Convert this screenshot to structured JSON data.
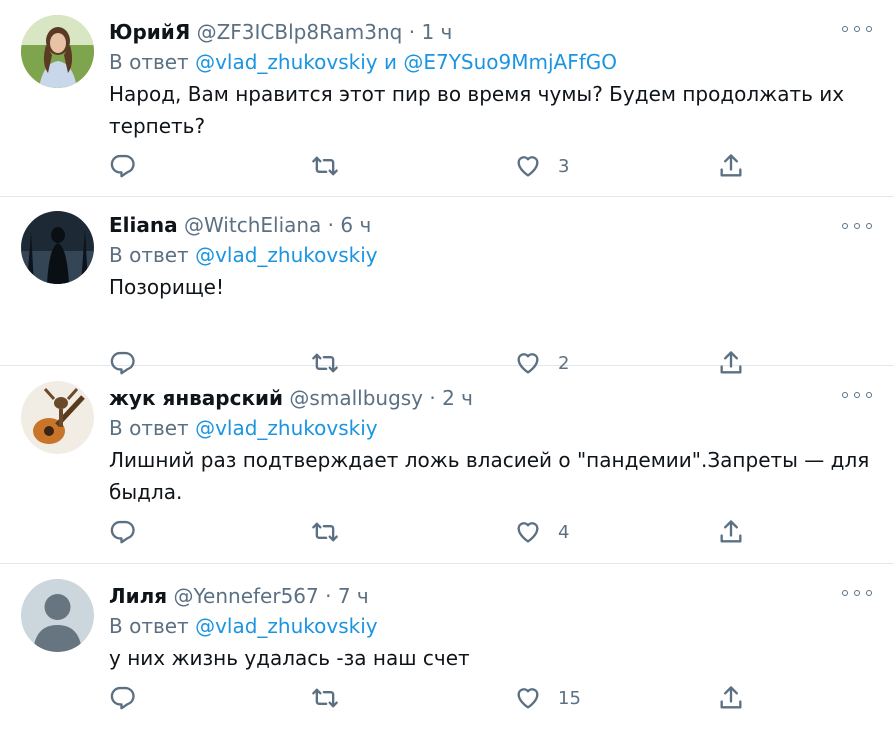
{
  "reply_prefix": "В ответ",
  "tweets": [
    {
      "name": "ЮрийЯ",
      "handle": "@ZF3ICBlp8Ram3nq",
      "time": "1 ч",
      "reply_mention": "@vlad_zhukovskiy",
      "reply_joiner": "и",
      "reply_mention2": "@E7YSuo9MmjAFfGO",
      "text": "Народ, Вам нравится этот пир во время чумы? Будем продолжать их терпеть?",
      "likes": "3"
    },
    {
      "name": "Eliana",
      "handle": "@WitchEliana",
      "time": "6 ч",
      "reply_mention": "@vlad_zhukovskiy",
      "text": "Позорище!",
      "likes": "2"
    },
    {
      "name": "жук январский",
      "handle": "@smallbugsy",
      "time": "2 ч",
      "reply_mention": "@vlad_zhukovskiy",
      "text": "Лишний раз подтверждает ложь власией о \"пандемии\".Запреты — для быдла.",
      "likes": "4"
    },
    {
      "name": "Лиля",
      "handle": "@Yennefer567",
      "time": "7 ч",
      "reply_mention": "@vlad_zhukovskiy",
      "text": "у них жизнь удалась -за наш счет",
      "likes": "15"
    }
  ],
  "separator": "·",
  "colors": {
    "accent": "#1b95e0",
    "secondary_text": "#5b7083",
    "divider": "#e1e8ed"
  }
}
